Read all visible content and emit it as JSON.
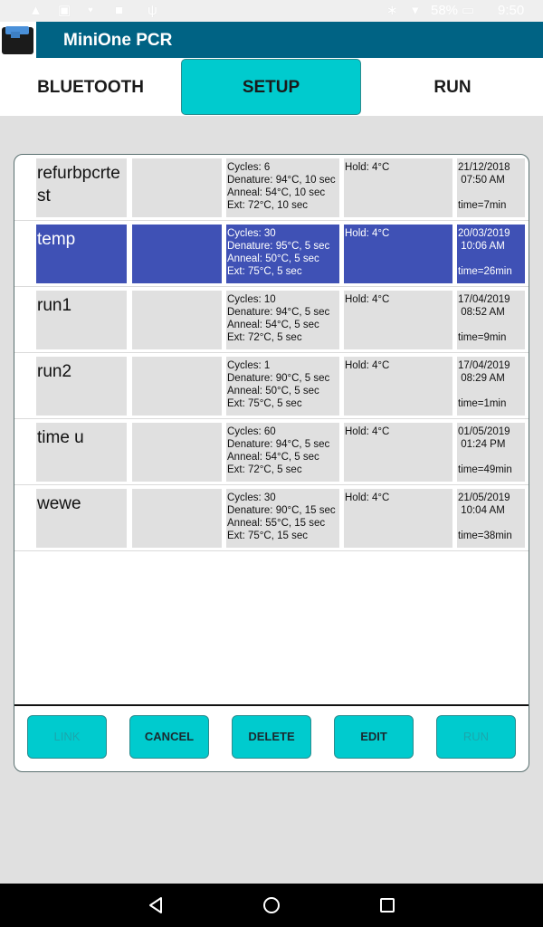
{
  "status_bar": {
    "left_icons": [
      "warning-icon",
      "image-icon",
      "shield-icon",
      "app-badge-icon",
      "usb-icon"
    ],
    "battery_percent": "58%",
    "time": "9:50"
  },
  "app": {
    "title": "MiniOne PCR"
  },
  "tabs": [
    {
      "label": "BLUETOOTH",
      "active": false
    },
    {
      "label": "SETUP",
      "active": true
    },
    {
      "label": "RUN",
      "active": false
    }
  ],
  "protocols": [
    {
      "name": "refurbpcrtest",
      "cycles": "Cycles: 6",
      "denature": "Denature: 94°C, 10 sec",
      "anneal": "Anneal: 54°C, 10 sec",
      "ext": "Ext: 72°C, 10 sec",
      "hold": "Hold: 4°C",
      "date": "21/12/2018",
      "time": " 07:50 AM",
      "duration": "time=7min",
      "selected": false
    },
    {
      "name": "temp",
      "cycles": "Cycles: 30",
      "denature": "Denature: 95°C, 5 sec",
      "anneal": "Anneal: 50°C, 5 sec",
      "ext": "Ext: 75°C, 5 sec",
      "hold": "Hold: 4°C",
      "date": "20/03/2019",
      "time": " 10:06 AM",
      "duration": "time=26min",
      "selected": true
    },
    {
      "name": "run1",
      "cycles": "Cycles: 10",
      "denature": "Denature: 94°C, 5 sec",
      "anneal": "Anneal: 54°C, 5 sec",
      "ext": "Ext: 72°C, 5 sec",
      "hold": "Hold: 4°C",
      "date": "17/04/2019",
      "time": " 08:52 AM",
      "duration": "time=9min",
      "selected": false
    },
    {
      "name": "run2",
      "cycles": "Cycles: 1",
      "denature": "Denature: 90°C, 5 sec",
      "anneal": "Anneal: 50°C, 5 sec",
      "ext": "Ext: 75°C, 5 sec",
      "hold": "Hold: 4°C",
      "date": "17/04/2019",
      "time": " 08:29 AM",
      "duration": "time=1min",
      "selected": false
    },
    {
      "name": "time u",
      "cycles": "Cycles: 60",
      "denature": "Denature: 94°C, 5 sec",
      "anneal": "Anneal: 54°C, 5 sec",
      "ext": "Ext: 72°C, 5 sec",
      "hold": "Hold: 4°C",
      "date": "01/05/2019",
      "time": " 01:24 PM",
      "duration": "time=49min",
      "selected": false
    },
    {
      "name": "wewe",
      "cycles": "Cycles: 30",
      "denature": "Denature: 90°C, 15 sec",
      "anneal": "Anneal: 55°C, 15 sec",
      "ext": "Ext: 75°C, 15 sec",
      "hold": "Hold: 4°C",
      "date": "21/05/2019",
      "time": " 10:04 AM",
      "duration": "time=38min",
      "selected": false
    }
  ],
  "actions": [
    {
      "label": "LINK",
      "enabled": false
    },
    {
      "label": "CANCEL",
      "enabled": true
    },
    {
      "label": "DELETE",
      "enabled": true
    },
    {
      "label": "EDIT",
      "enabled": true
    },
    {
      "label": "RUN",
      "enabled": false
    }
  ],
  "colors": {
    "app_bar": "#006384",
    "accent": "#00cbce",
    "selected_row": "#3f51b5",
    "cell_bg": "#e0e0e0"
  }
}
